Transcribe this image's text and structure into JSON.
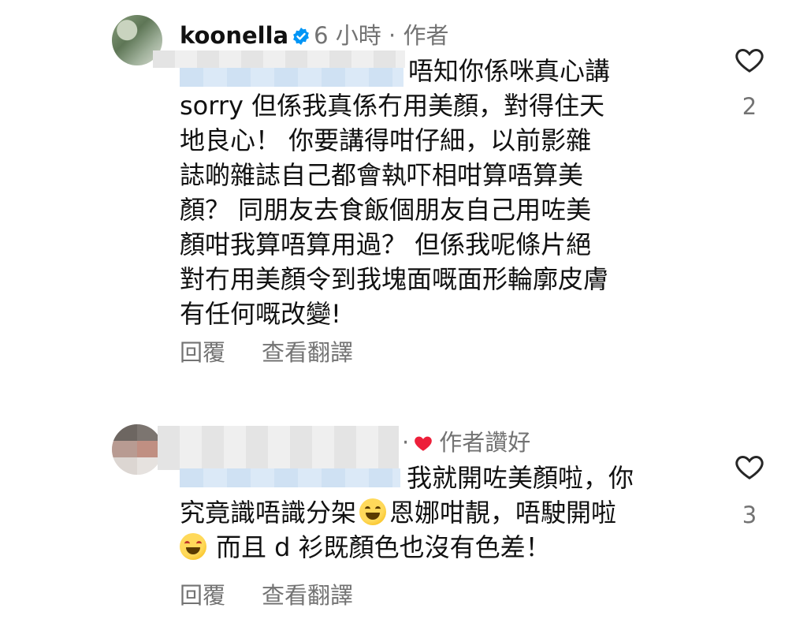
{
  "comments": [
    {
      "username": "koonella",
      "time": "6 小時",
      "separator": "·",
      "badge": "作者",
      "text_lines": [
        "唔知你係咪真心講",
        "sorry 但係我真係冇用美顏，對得住天",
        "地良心！  你要講得咁仔細，以前影雜",
        "誌啲雜誌自己都會執吓相咁算唔算美",
        "顏？  同朋友去食飯個朋友自己用咗美",
        "顏咁我算唔算用過？  但係我呢條片絕",
        "對冇用美顏令到我塊面嘅面形輪廓皮膚",
        "有任何嘅改變!"
      ],
      "reply_label": "回覆",
      "translate_label": "查看翻譯",
      "like_count": "2"
    },
    {
      "time_fragment": "·",
      "liked_by_author_label": "作者讚好",
      "text_lines": [
        "我就開咗美顏啦，你",
        "究竟識唔識分架",
        "恩娜咁靚，唔駛開啦",
        "而且 d 衫既顏色也沒有色差！"
      ],
      "reply_label": "回覆",
      "translate_label": "查看翻譯",
      "like_count": "3"
    }
  ],
  "icons": {
    "like": "heart-outline-icon",
    "verified": "verified-badge-icon",
    "author_liked": "red-heart-icon",
    "emoji_1": "grinning-squinting-face-emoji",
    "emoji_2": "star-struck-face-emoji"
  },
  "colors": {
    "verified_blue": "#0095f6",
    "heart_red": "#ed1f3a",
    "meta_gray": "#737373"
  }
}
